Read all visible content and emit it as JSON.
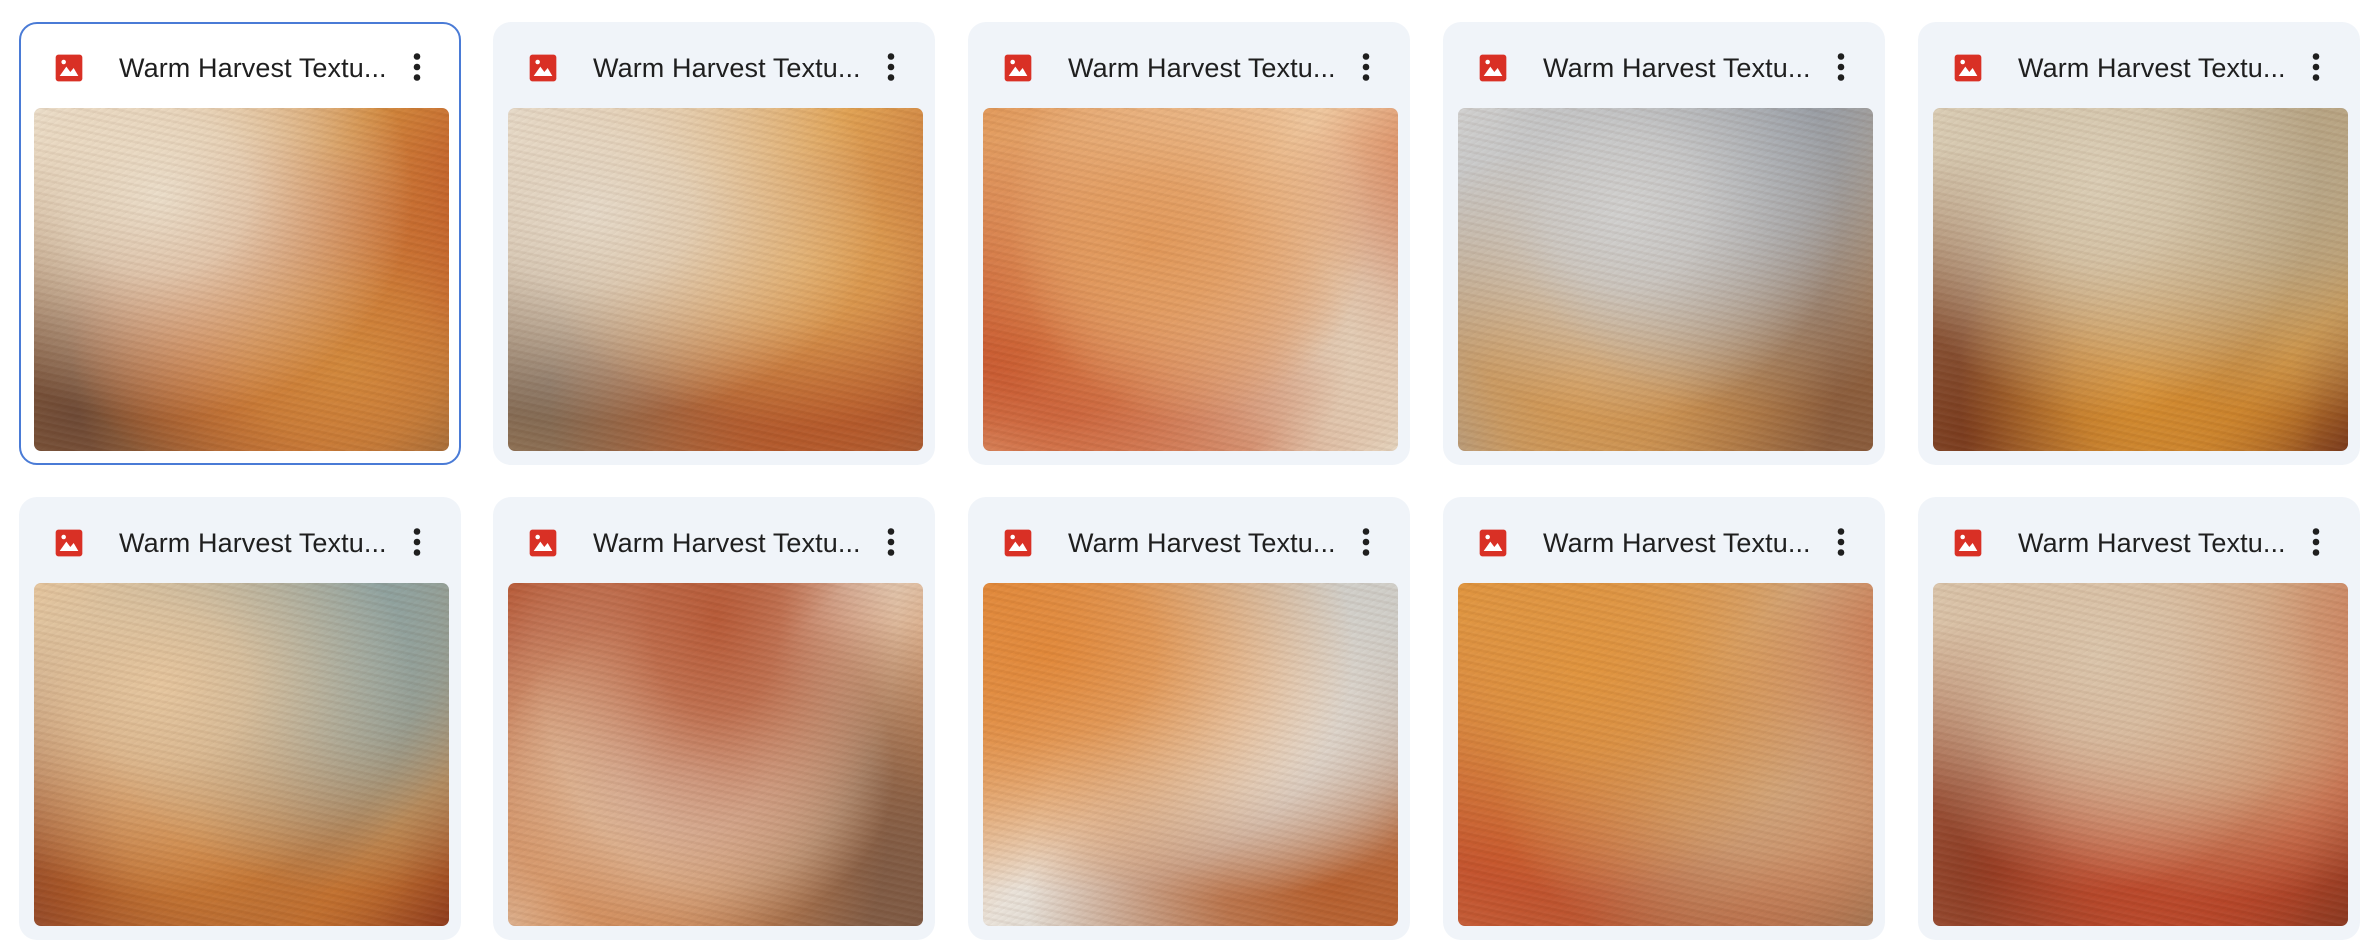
{
  "files": [
    {
      "name": "Warm Harvest Textu...",
      "selected": true,
      "file_type_icon": "image-icon",
      "menu_icon": "more-vert-icon",
      "palette": [
        "#ede0cc",
        "#d48a3c",
        "#b8401c",
        "#6e4a36"
      ]
    },
    {
      "name": "Warm Harvest Textu...",
      "selected": false,
      "file_type_icon": "image-icon",
      "menu_icon": "more-vert-icon",
      "palette": [
        "#e8dccb",
        "#e3a454",
        "#b85a2a",
        "#7c6654"
      ]
    },
    {
      "name": "Warm Harvest Textu...",
      "selected": false,
      "file_type_icon": "image-icon",
      "menu_icon": "more-vert-icon",
      "palette": [
        "#e49a5a",
        "#f1c9a0",
        "#c9542a",
        "#e7d8c2"
      ]
    },
    {
      "name": "Warm Harvest Textu...",
      "selected": false,
      "file_type_icon": "image-icon",
      "menu_icon": "more-vert-icon",
      "palette": [
        "#d3d3d2",
        "#9aa0a8",
        "#d79a52",
        "#8a5c3c"
      ]
    },
    {
      "name": "Warm Harvest Textu...",
      "selected": false,
      "file_type_icon": "image-icon",
      "menu_icon": "more-vert-icon",
      "palette": [
        "#ddd0b8",
        "#b9a889",
        "#d88e2e",
        "#7a3a1c"
      ]
    },
    {
      "name": "Warm Harvest Textu...",
      "selected": false,
      "file_type_icon": "image-icon",
      "menu_icon": "more-vert-icon",
      "palette": [
        "#e8c8a0",
        "#8fa4a2",
        "#cf7d33",
        "#8e3a1c"
      ]
    },
    {
      "name": "Warm Harvest Textu...",
      "selected": false,
      "file_type_icon": "image-icon",
      "menu_icon": "more-vert-icon",
      "palette": [
        "#b95b38",
        "#e6d4c2",
        "#d58a54",
        "#7e5a44"
      ]
    },
    {
      "name": "Warm Harvest Textu...",
      "selected": false,
      "file_type_icon": "image-icon",
      "menu_icon": "more-vert-icon",
      "palette": [
        "#e48a3a",
        "#ece5dc",
        "#c7c8c4",
        "#b8602e"
      ]
    },
    {
      "name": "Warm Harvest Textu...",
      "selected": false,
      "file_type_icon": "image-icon",
      "menu_icon": "more-vert-icon",
      "palette": [
        "#e3963e",
        "#d2a77e",
        "#c6502a",
        "#9a6a48"
      ]
    },
    {
      "name": "Warm Harvest Textu...",
      "selected": false,
      "file_type_icon": "image-icon",
      "menu_icon": "more-vert-icon",
      "palette": [
        "#ddc8ae",
        "#d4a47e",
        "#c0482a",
        "#8b3820"
      ]
    }
  ],
  "colors": {
    "card_background": "#f0f4f9",
    "selected_border": "#4a7bd6",
    "image_icon_red": "#d93025",
    "title_text": "#1f1f1f",
    "menu_dots": "#1f1f1f"
  }
}
